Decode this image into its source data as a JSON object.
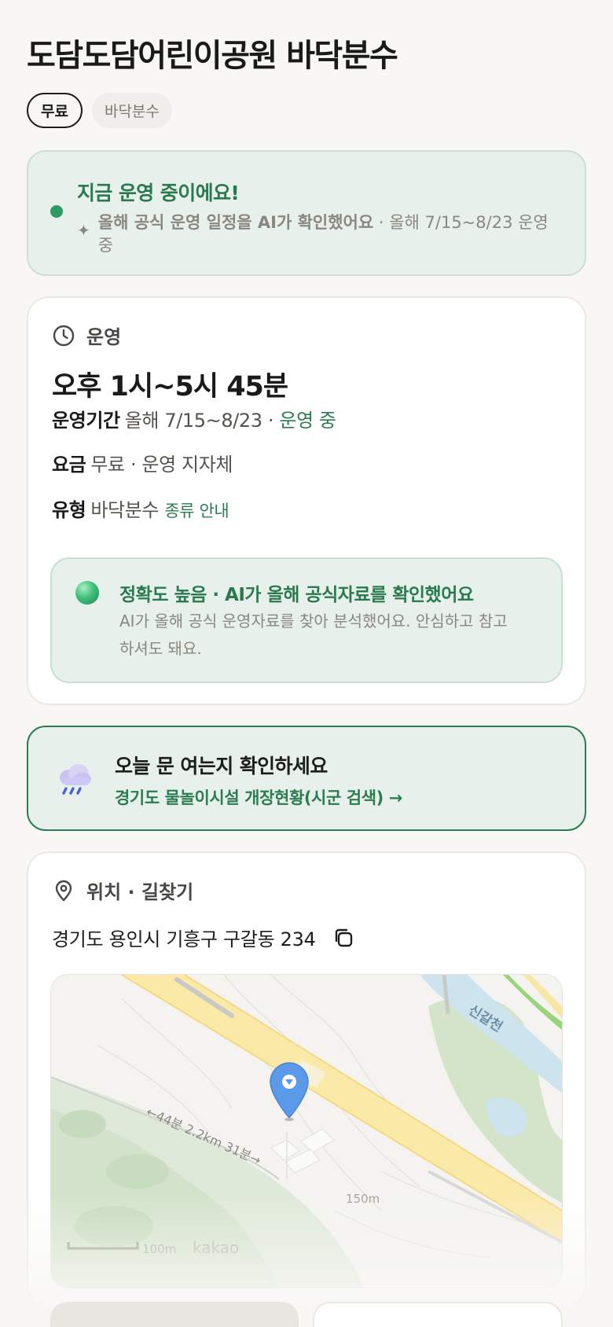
{
  "header": {
    "title": "도담도담어린이공원 바닥분수",
    "tags": {
      "fee": "무료",
      "type": "바닥분수"
    }
  },
  "status": {
    "title": "지금 운영 중이에요!",
    "ai_text": "올해 공식 운영 일정을 AI가 확인했어요",
    "period_text": " · 올해 7/15~8/23 운영 중"
  },
  "operation": {
    "section_label": "운영",
    "hours": "오후 1시~5시 45분",
    "period_label": "운영기간",
    "period_value": "올해 7/15~8/23 · ",
    "period_status": "운영 중",
    "fee_label": "요금",
    "fee_value": "무료 · 운영 지자체",
    "type_label": "유형",
    "type_value": "바닥분수 ",
    "type_link": "종류 안내",
    "accuracy": {
      "title": "정확도 높음 · AI가 올해 공식자료를 확인했어요",
      "desc": "AI가 올해 공식 운영자료를 찾아 분석했어요. 안심하고 참고하셔도 돼요."
    }
  },
  "check": {
    "title": "오늘 문 여는지 확인하세요",
    "link": "경기도 물놀이시설 개장현황(시군 검색) →"
  },
  "location": {
    "section_label": "위치 · 길찾기",
    "address": "경기도 용인시 기흥구 구갈동 234",
    "map": {
      "river_label": "신갈천",
      "route_label": "←44분 2.2km 31분→",
      "contour_label": "150m",
      "scale_label": "100m",
      "provider": "kakao"
    }
  },
  "colors": {
    "accent_green": "#2b7c51",
    "status_bg": "#e7f0ea",
    "page_bg": "#f8f7f4"
  }
}
